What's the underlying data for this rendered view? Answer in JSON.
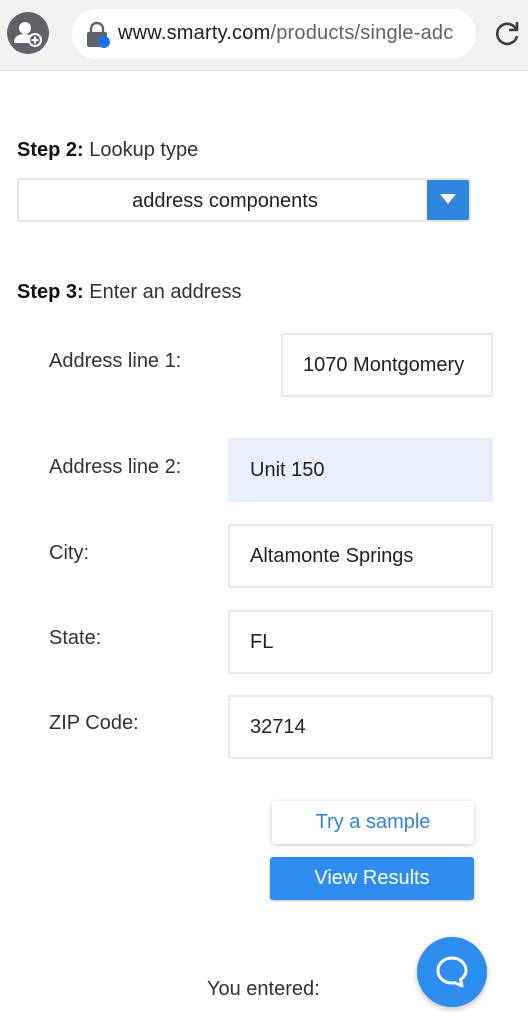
{
  "browser": {
    "url_domain": "www.smarty.com",
    "url_path": "/products/single-adc"
  },
  "steps": {
    "step2_bold": "Step 2:",
    "step2_text": " Lookup type",
    "step3_bold": "Step 3:",
    "step3_text": " Enter an address"
  },
  "lookup_type": {
    "selected": "address components"
  },
  "fields": {
    "address1": {
      "label": "Address line 1:",
      "value": "1070 Montgomery"
    },
    "address2": {
      "label": "Address line 2:",
      "value": "Unit 150"
    },
    "city": {
      "label": "City:",
      "value": "Altamonte Springs"
    },
    "state": {
      "label": "State:",
      "value": "FL"
    },
    "zip": {
      "label": "ZIP Code:",
      "value": "32714"
    }
  },
  "buttons": {
    "try_sample": "Try a sample",
    "view_results": "View Results"
  },
  "results": {
    "entered_label": "You entered:"
  },
  "colors": {
    "accent": "#2e8ef0",
    "highlight_field": "#e8f0fe"
  },
  "icons": [
    "profile-icon",
    "lock-icon",
    "reload-icon",
    "dropdown-arrow-icon",
    "chat-icon"
  ]
}
